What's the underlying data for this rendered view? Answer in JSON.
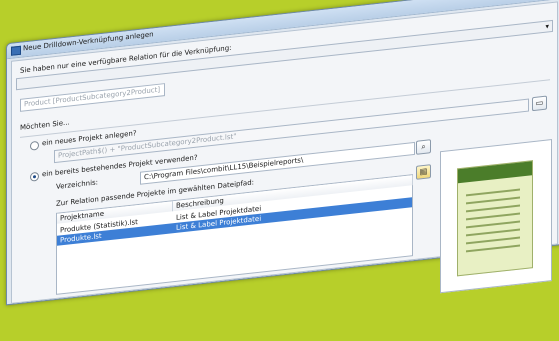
{
  "window": {
    "title": "Neue Drilldown-Verknüpfung anlegen",
    "close_glyph": "x"
  },
  "relation": {
    "label": "Sie haben nur eine verfügbare Relation für die Verknüpfung:",
    "value": "Product [ProductSubcategory2Product]",
    "dropdown_glyph": "▾"
  },
  "question": "Möchten Sie...",
  "option_new": {
    "label": "ein neues Projekt anlegen?",
    "path": "ProjectPath$() + \"ProductSubcategory2Product.lst\"",
    "selected": false
  },
  "option_existing": {
    "label": "ein bereits bestehendes Projekt verwenden?",
    "selected": true,
    "dir_label": "Verzeichnis:",
    "dir_value": "C:\\Program Files\\combit\\LL15\\Beispielreports\\",
    "list_label": "Zur Relation passende Projekte im gewählten Dateipfad:"
  },
  "table": {
    "columns": [
      "Projektname",
      "Beschreibung"
    ],
    "rows": [
      {
        "name": "Produkte (Statistik).lst",
        "desc": "List & Label Projektdatei",
        "selected": false
      },
      {
        "name": "Produkte.lst",
        "desc": "List & Label Projektdatei",
        "selected": true
      }
    ]
  },
  "icons": {
    "formula": "formula-icon",
    "search": "magnifier-icon",
    "folder": "folder-icon"
  }
}
